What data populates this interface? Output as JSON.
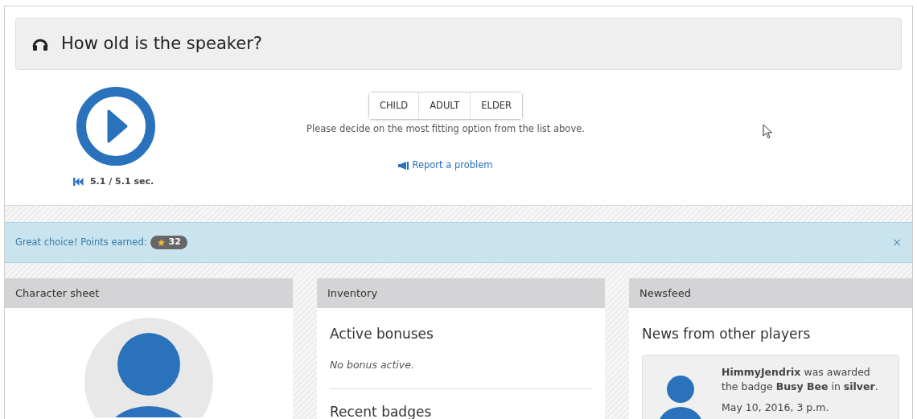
{
  "question": {
    "title": "How old is the speaker?"
  },
  "player": {
    "time": "5.1 / 5.1 sec."
  },
  "options": [
    {
      "label": "CHILD",
      "selected": false
    },
    {
      "label": "ADULT",
      "selected": false
    },
    {
      "label": "ELDER",
      "selected": false
    }
  ],
  "hint": "Please decide on the most fitting option from the list above.",
  "report_link": "Report a problem",
  "alert": {
    "message": "Great choice! Points earned:",
    "points": "32",
    "close": "×"
  },
  "panels": [
    {
      "kind": "character",
      "title": "Character sheet"
    },
    {
      "kind": "inventory",
      "title": "Inventory",
      "sections": [
        {
          "heading": "Active bonuses",
          "text": "No bonus active."
        },
        {
          "heading": "Recent badges"
        }
      ]
    },
    {
      "kind": "newsfeed",
      "title": "Newsfeed",
      "heading": "News from other players",
      "items": [
        {
          "text": "**HimmyJendrix** was awarded the badge **Busy Bee** in **silver**.",
          "date": "May 10, 2016, 3 p.m."
        }
      ]
    }
  ]
}
